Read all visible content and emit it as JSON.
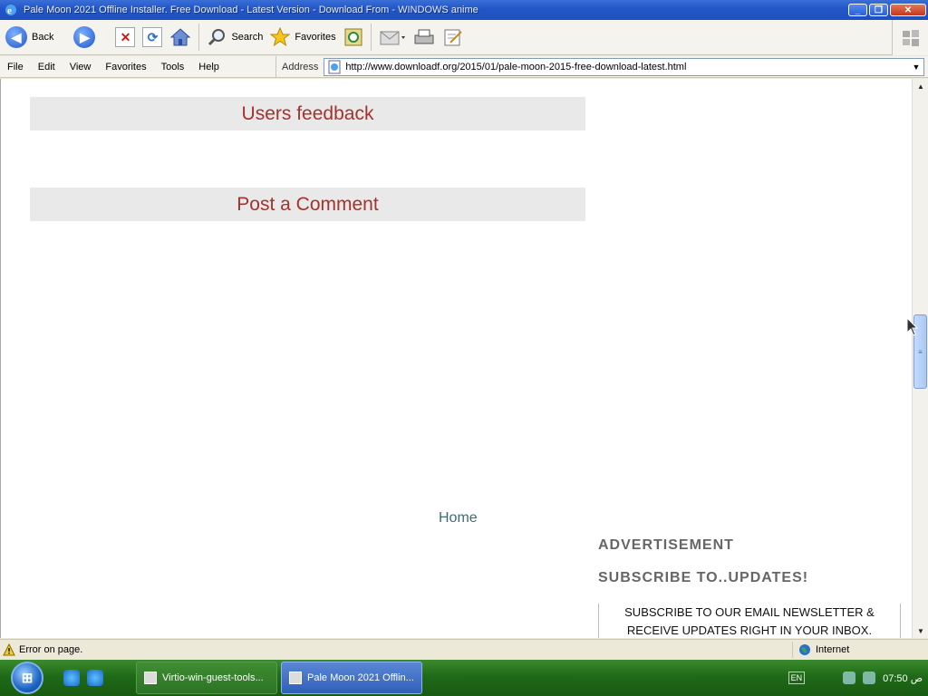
{
  "window": {
    "title": "Pale Moon 2021 Offline Installer. Free Download - Latest Version - Download From - WINDOWS anime"
  },
  "toolbar": {
    "back_label": "Back",
    "search_label": "Search",
    "favorites_label": "Favorites"
  },
  "menu": {
    "items": [
      "File",
      "Edit",
      "View",
      "Favorites",
      "Tools",
      "Help"
    ]
  },
  "address": {
    "label": "Address",
    "url": "http://www.downloadf.org/2015/01/pale-moon-2015-free-download-latest.html"
  },
  "page": {
    "users_feedback": "Users feedback",
    "post_comment": "Post a Comment",
    "home_link": "Home",
    "sidebar": {
      "advertisement": "ADVERTISEMENT",
      "subscribe_heading": "SUBSCRIBE TO..UPDATES!",
      "subscribe_text_line1": "SUBSCRIBE TO OUR EMAIL NEWSLETTER &",
      "subscribe_text_line2": "RECEIVE UPDATES RIGHT IN YOUR INBOX."
    }
  },
  "status": {
    "message": "Error on page.",
    "zone": "Internet"
  },
  "taskbar": {
    "tasks": [
      {
        "label": "Virtio-win-guest-tools...",
        "active": false
      },
      {
        "label": "Pale Moon 2021 Offlin...",
        "active": true
      }
    ],
    "language": "EN",
    "clock": "07:50 ص"
  },
  "colors": {
    "header_text": "#a5322c",
    "header_bg": "#e9e9e9",
    "link": "#3f6b73",
    "sidebar_heading": "#666666",
    "titlebar": "#2457c8",
    "taskbar": "#1f6a18"
  }
}
